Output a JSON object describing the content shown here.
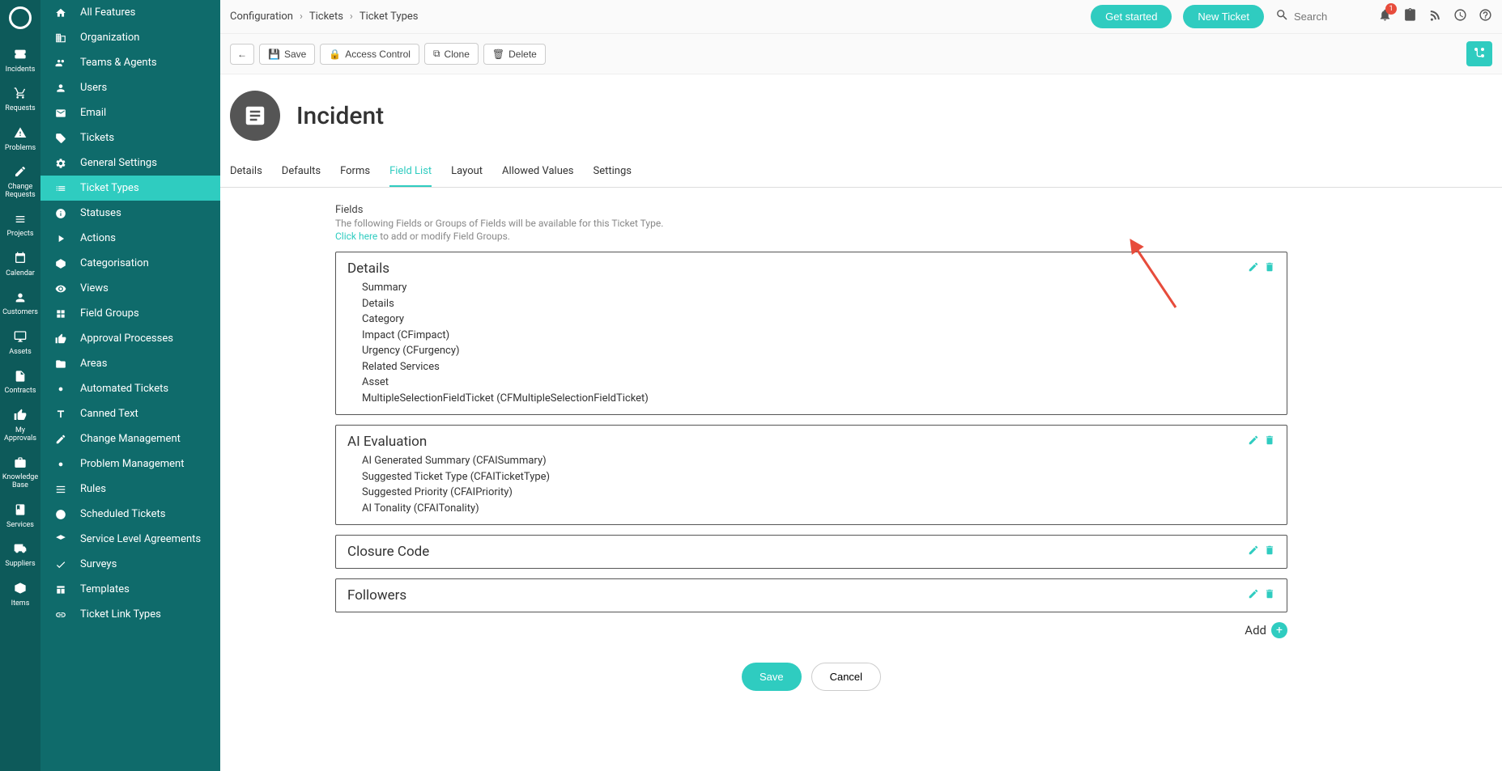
{
  "rail": {
    "items": [
      {
        "icon": "ticket",
        "label": "Incidents"
      },
      {
        "icon": "cart",
        "label": "Requests"
      },
      {
        "icon": "warning",
        "label": "Problems"
      },
      {
        "icon": "edit",
        "label": "Change Requests"
      },
      {
        "icon": "stack",
        "label": "Projects"
      },
      {
        "icon": "calendar",
        "label": "Calendar"
      },
      {
        "icon": "person",
        "label": "Customers"
      },
      {
        "icon": "monitor",
        "label": "Assets"
      },
      {
        "icon": "doc",
        "label": "Contracts"
      },
      {
        "icon": "thumb",
        "label": "My Approvals"
      },
      {
        "icon": "box",
        "label": "Knowledge Base"
      },
      {
        "icon": "book",
        "label": "Services"
      },
      {
        "icon": "truck",
        "label": "Suppliers"
      },
      {
        "icon": "cube",
        "label": "Items"
      }
    ]
  },
  "sidebar": {
    "items": [
      {
        "icon": "home",
        "label": "All Features"
      },
      {
        "icon": "building",
        "label": "Organization"
      },
      {
        "icon": "people",
        "label": "Teams & Agents"
      },
      {
        "icon": "user",
        "label": "Users"
      },
      {
        "icon": "mail",
        "label": "Email"
      },
      {
        "icon": "tag",
        "label": "Tickets"
      },
      {
        "icon": "gear",
        "label": "General Settings",
        "sub": true
      },
      {
        "icon": "list",
        "label": "Ticket Types",
        "sub": true,
        "active": true
      },
      {
        "icon": "info",
        "label": "Statuses",
        "sub": true
      },
      {
        "icon": "play",
        "label": "Actions",
        "sub": true
      },
      {
        "icon": "cat",
        "label": "Categorisation",
        "sub": true
      },
      {
        "icon": "eye",
        "label": "Views",
        "sub": true
      },
      {
        "icon": "grid",
        "label": "Field Groups",
        "sub": true
      },
      {
        "icon": "thumb",
        "label": "Approval Processes",
        "sub": true
      },
      {
        "icon": "folder",
        "label": "Areas",
        "sub": true
      },
      {
        "icon": "gears",
        "label": "Automated Tickets",
        "sub": true
      },
      {
        "icon": "text",
        "label": "Canned Text",
        "sub": true
      },
      {
        "icon": "edit",
        "label": "Change Management",
        "sub": true
      },
      {
        "icon": "gears",
        "label": "Problem Management",
        "sub": true
      },
      {
        "icon": "lines",
        "label": "Rules",
        "sub": true
      },
      {
        "icon": "clock",
        "label": "Scheduled Tickets",
        "sub": true
      },
      {
        "icon": "sla",
        "label": "Service Level Agreements",
        "sub": true
      },
      {
        "icon": "check",
        "label": "Surveys",
        "sub": true
      },
      {
        "icon": "template",
        "label": "Templates",
        "sub": true
      },
      {
        "icon": "link",
        "label": "Ticket Link Types",
        "sub": true
      }
    ]
  },
  "breadcrumb": [
    "Configuration",
    "Tickets",
    "Ticket Types"
  ],
  "topbar": {
    "get_started": "Get started",
    "new_ticket": "New Ticket",
    "search_placeholder": "Search",
    "notification_count": "1"
  },
  "actionbar": {
    "save": "Save",
    "access_control": "Access Control",
    "clone": "Clone",
    "delete": "Delete"
  },
  "page_title": "Incident",
  "tabs": [
    "Details",
    "Defaults",
    "Forms",
    "Field List",
    "Layout",
    "Allowed Values",
    "Settings"
  ],
  "active_tab": "Field List",
  "fields_section": {
    "title": "Fields",
    "help": "The following Fields or Groups of Fields will be available for this Ticket Type.",
    "link_text": "Click here",
    "link_suffix": " to add or modify Field Groups."
  },
  "groups": [
    {
      "title": "Details",
      "fields": [
        "Summary",
        "Details",
        "Category",
        "Impact (CFimpact)",
        "Urgency (CFurgency)",
        "Related Services",
        "Asset",
        "MultipleSelectionFieldTicket (CFMultipleSelectionFieldTicket)"
      ]
    },
    {
      "title": "AI Evaluation",
      "fields": [
        "AI Generated Summary (CFAISummary)",
        "Suggested Ticket Type (CFAITicketType)",
        "Suggested Priority (CFAIPriority)",
        "AI Tonality (CFAITonality)"
      ]
    },
    {
      "title": "Closure Code",
      "fields": []
    },
    {
      "title": "Followers",
      "fields": []
    }
  ],
  "add_label": "Add",
  "footer": {
    "save": "Save",
    "cancel": "Cancel"
  }
}
